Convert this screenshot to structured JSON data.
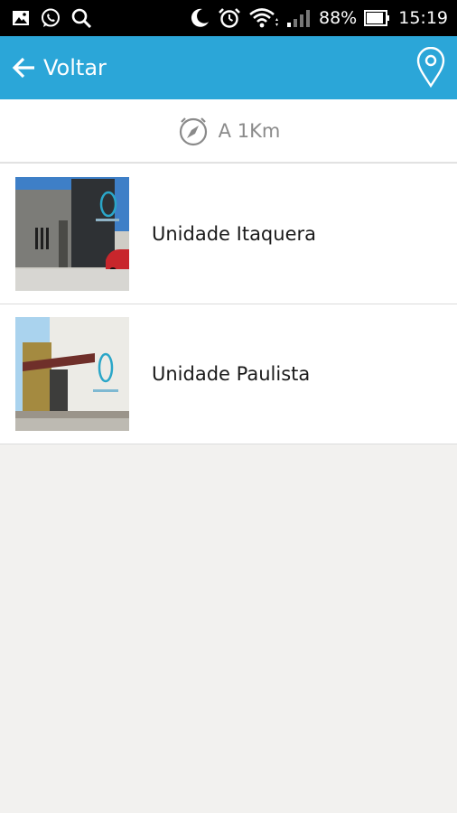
{
  "status_bar": {
    "battery": "88%",
    "time": "15:19",
    "icons": [
      "image-icon",
      "whatsapp-icon",
      "search-icon",
      "moon-icon",
      "alarm-icon",
      "wifi-icon",
      "signal-icon",
      "battery-icon"
    ]
  },
  "app_bar": {
    "back_label": "Voltar",
    "background": "#2ba6d8",
    "icons": [
      "arrow-left-icon",
      "map-pin-icon"
    ]
  },
  "filter": {
    "label": "A 1Km",
    "icon": "compass-icon"
  },
  "locations": [
    {
      "name": "Unidade Itaquera"
    },
    {
      "name": "Unidade Paulista"
    }
  ]
}
